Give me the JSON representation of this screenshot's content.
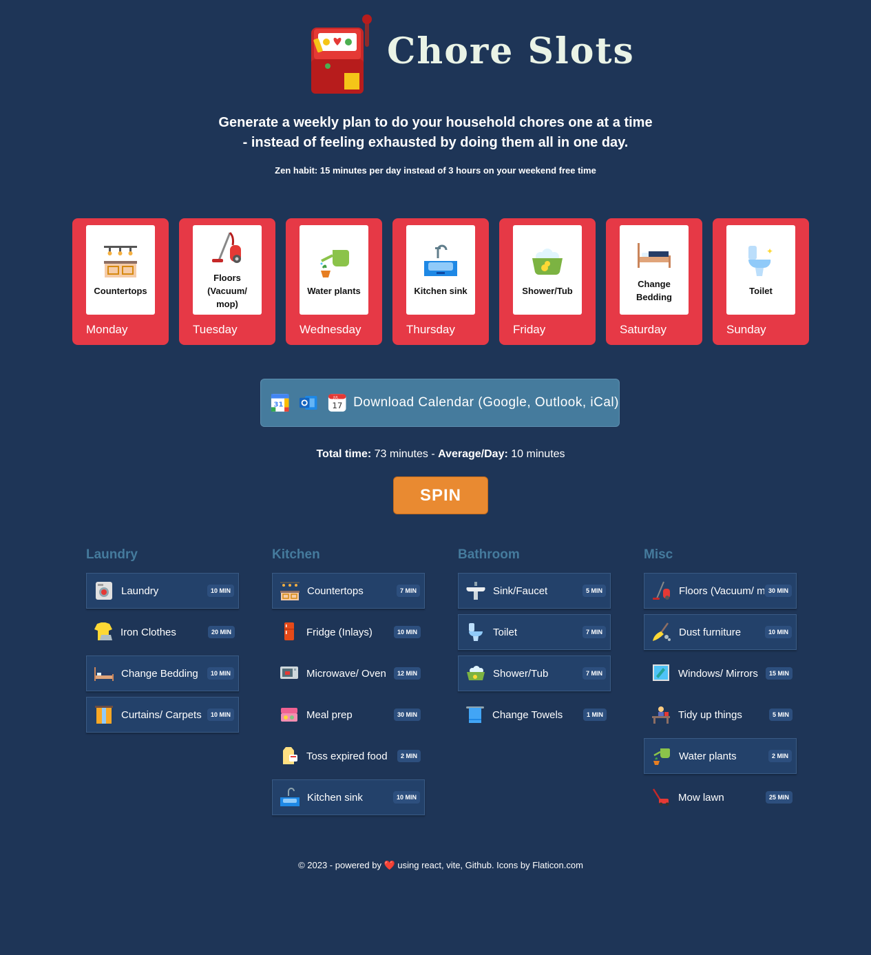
{
  "header": {
    "title": "Chore Slots",
    "tagline_line1": "Generate a weekly plan to do your household chores one at a time",
    "tagline_line2": "- instead of feeling exhausted by doing them all in one day.",
    "zen": "Zen habit: 15 minutes per day instead of 3 hours on your weekend free time",
    "logo_icon": "slot-machine-icon"
  },
  "week": [
    {
      "day": "Monday",
      "chore": "Countertops",
      "icon": "countertops-icon"
    },
    {
      "day": "Tuesday",
      "chore": "Floors (Vacuum/ mop)",
      "icon": "vacuum-icon"
    },
    {
      "day": "Wednesday",
      "chore": "Water plants",
      "icon": "watering-can-icon"
    },
    {
      "day": "Thursday",
      "chore": "Kitchen sink",
      "icon": "sink-icon"
    },
    {
      "day": "Friday",
      "chore": "Shower/Tub",
      "icon": "bathtub-icon"
    },
    {
      "day": "Saturday",
      "chore": "Change Bedding",
      "icon": "bed-icon"
    },
    {
      "day": "Sunday",
      "chore": "Toilet",
      "icon": "toilet-icon"
    }
  ],
  "calendar": {
    "label": "Download Calendar  (Google, Outlook, iCal)",
    "ical_day": "17",
    "ical_month": "JUL"
  },
  "totals": {
    "total_label": "Total time:",
    "total_value": "73 minutes",
    "sep": "-",
    "avg_label": "Average/Day:",
    "avg_value": "10 minutes"
  },
  "spin_label": "SPIN",
  "categories": [
    {
      "name": "Laundry",
      "items": [
        {
          "name": "Laundry",
          "time": "10 MIN",
          "selected": true
        },
        {
          "name": "Iron Clothes",
          "time": "20 MIN",
          "selected": false
        },
        {
          "name": "Change Bedding",
          "time": "10 MIN",
          "selected": true
        },
        {
          "name": "Curtains/ Carpets",
          "time": "10 MIN",
          "selected": true
        }
      ]
    },
    {
      "name": "Kitchen",
      "items": [
        {
          "name": "Countertops",
          "time": "7 MIN",
          "selected": true
        },
        {
          "name": "Fridge (Inlays)",
          "time": "10 MIN",
          "selected": false
        },
        {
          "name": "Microwave/ Oven",
          "time": "12 MIN",
          "selected": false
        },
        {
          "name": "Meal prep",
          "time": "30 MIN",
          "selected": false
        },
        {
          "name": "Toss expired food",
          "time": "2 MIN",
          "selected": false
        },
        {
          "name": "Kitchen sink",
          "time": "10 MIN",
          "selected": true
        }
      ]
    },
    {
      "name": "Bathroom",
      "items": [
        {
          "name": "Sink/Faucet",
          "time": "5 MIN",
          "selected": true
        },
        {
          "name": "Toilet",
          "time": "7 MIN",
          "selected": true
        },
        {
          "name": "Shower/Tub",
          "time": "7 MIN",
          "selected": true
        },
        {
          "name": "Change Towels",
          "time": "1 MIN",
          "selected": false
        }
      ]
    },
    {
      "name": "Misc",
      "items": [
        {
          "name": "Floors (Vacuum/ mop)",
          "time": "30 MIN",
          "selected": true
        },
        {
          "name": "Dust furniture",
          "time": "10 MIN",
          "selected": true
        },
        {
          "name": "Windows/ Mirrors",
          "time": "15 MIN",
          "selected": false
        },
        {
          "name": "Tidy up things",
          "time": "5 MIN",
          "selected": false
        },
        {
          "name": "Water plants",
          "time": "2 MIN",
          "selected": true
        },
        {
          "name": "Mow lawn",
          "time": "25 MIN",
          "selected": false
        }
      ]
    }
  ],
  "footer": {
    "prefix": "© 2023 - powered by",
    "heart": "❤️",
    "suffix": "using react, vite, Github. Icons by Flaticon.com"
  },
  "colors": {
    "background": "#1e3557",
    "day_card": "#e63946",
    "calendar_button": "#457b9d",
    "spin_button": "#e98a31",
    "category_heading": "#457b9d",
    "selected_item": "#23416a"
  }
}
